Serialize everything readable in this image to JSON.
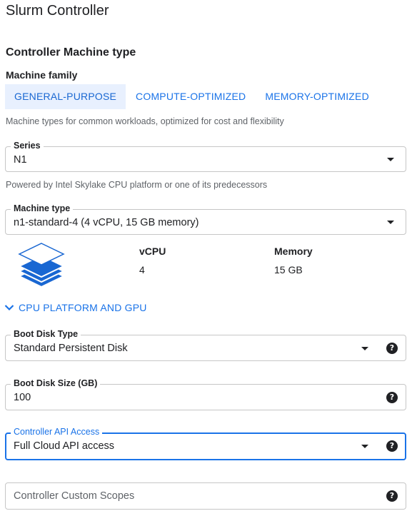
{
  "page": {
    "title": "Slurm Controller"
  },
  "machine": {
    "section_title": "Controller Machine type",
    "family_label": "Machine family",
    "tabs": [
      {
        "label": "GENERAL-PURPOSE",
        "active": true
      },
      {
        "label": "COMPUTE-OPTIMIZED",
        "active": false
      },
      {
        "label": "MEMORY-OPTIMIZED",
        "active": false
      }
    ],
    "family_help": "Machine types for common workloads, optimized for cost and flexibility",
    "series": {
      "label": "Series",
      "value": "N1",
      "help": "Powered by Intel Skylake CPU platform or one of its predecessors"
    },
    "machine_type": {
      "label": "Machine type",
      "value": "n1-standard-4 (4 vCPU, 15 GB memory)"
    },
    "specs": {
      "vcpu_label": "vCPU",
      "vcpu_value": "4",
      "memory_label": "Memory",
      "memory_value": "15 GB"
    },
    "cpu_platform_toggle": "CPU PLATFORM AND GPU"
  },
  "boot_disk_type": {
    "label": "Boot Disk Type",
    "value": "Standard Persistent Disk"
  },
  "boot_disk_size": {
    "label": "Boot Disk Size (GB)",
    "value": "100"
  },
  "api_access": {
    "label": "Controller API Access",
    "value": "Full Cloud API access"
  },
  "custom_scopes": {
    "placeholder": "Controller Custom Scopes"
  },
  "icons": {
    "dropdown": "caret-down-icon",
    "help": "help-circle-icon",
    "expand": "chevron-down-icon",
    "machine": "layers-stack-icon"
  },
  "colors": {
    "accent": "#1a73e8",
    "tab_active_bg": "#e8f0fe",
    "stack_blue": "#1967d2"
  }
}
